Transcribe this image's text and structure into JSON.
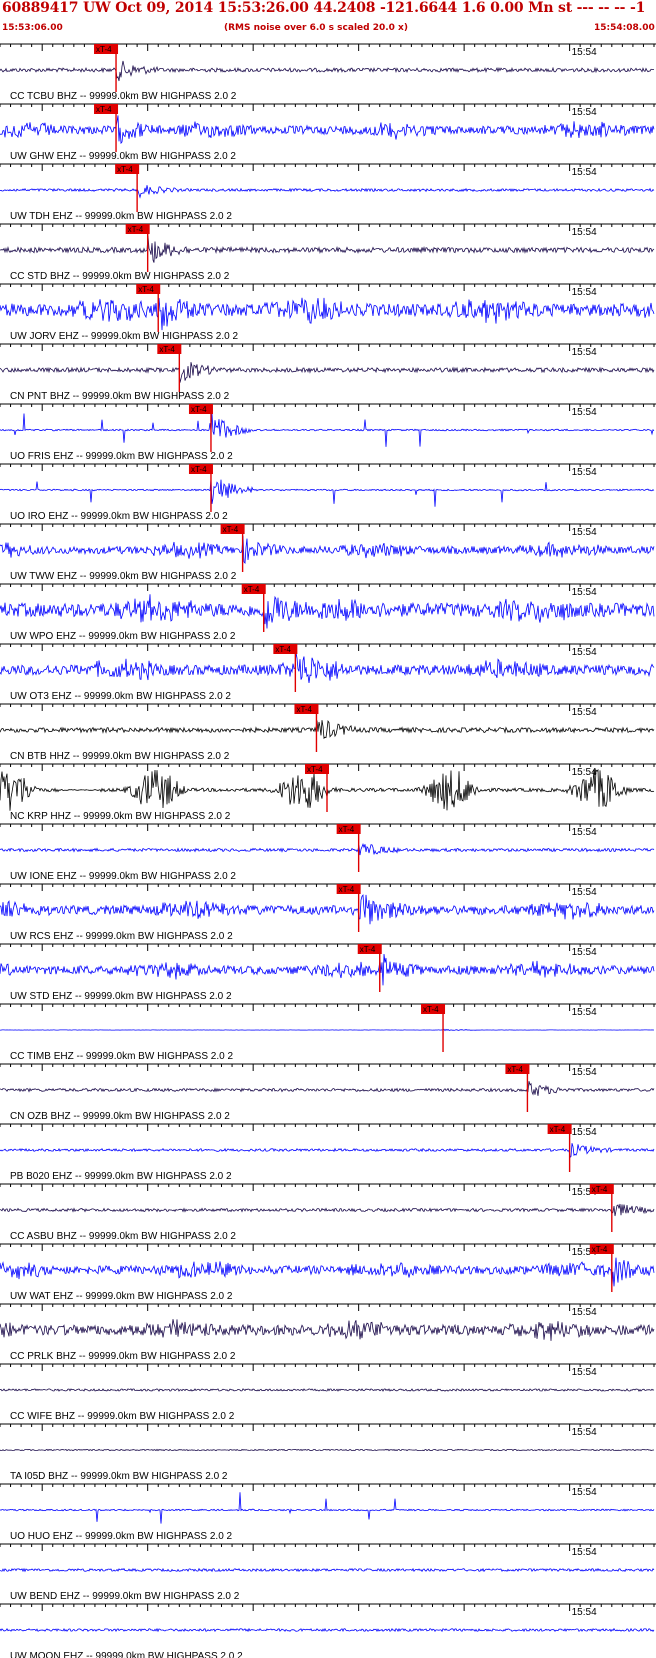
{
  "header": {
    "title": "60889417 UW Oct 09, 2014 15:53:26.00   44.2408 -121.6644  1.6 0.00 Mn st --- -- --  -1",
    "start_time": "15:53:06.00",
    "note": "(RMS noise over 6.0 s scaled 20.0 x)",
    "end_time": "15:54:08.00"
  },
  "colors": {
    "header_text": "#c00000",
    "pick": "#e00000",
    "blue_trace": "#0000ff",
    "dark_trace": "#1a0a4a",
    "black_trace": "#000000",
    "axis": "#000000"
  },
  "chart_data": {
    "type": "line",
    "xlim_seconds": [
      0,
      62
    ],
    "minute_tick_label": "15:54",
    "pick_label": "xT-4",
    "filter_suffix": "99999.0km BW  HIGHPASS  2.0  2",
    "traces": [
      {
        "station": "CC TCBU BHZ",
        "label": "CC TCBU BHZ --  99999.0km BW  HIGHPASS  2.0  2",
        "color": "dark",
        "pick_s": 11.0,
        "pattern": "burst",
        "amp": 0.45
      },
      {
        "station": "UW GHW EHZ",
        "label": "UW GHW EHZ --  99999.0km BW  HIGHPASS  2.0  2",
        "color": "blue",
        "pick_s": 11.0,
        "pattern": "noisy",
        "amp": 0.5
      },
      {
        "station": "UW TDH EHZ",
        "label": "UW TDH EHZ --  99999.0km BW  HIGHPASS  2.0  2",
        "color": "blue",
        "pick_s": 13.0,
        "pattern": "quiet",
        "amp": 0.3
      },
      {
        "station": "CC STD BHZ",
        "label": "CC STD BHZ --  99999.0km BW  HIGHPASS  2.0  2",
        "color": "dark",
        "pick_s": 14.0,
        "pattern": "burst",
        "amp": 0.6
      },
      {
        "station": "UW JORV EHZ",
        "label": "UW JORV EHZ --  99999.0km BW  HIGHPASS  2.0  2",
        "color": "blue",
        "pick_s": 15.0,
        "pattern": "noisy",
        "amp": 0.75
      },
      {
        "station": "CN PNT BHZ",
        "label": "CN PNT BHZ --  99999.0km BW  HIGHPASS  2.0  2",
        "color": "dark",
        "pick_s": 17.0,
        "pattern": "burst",
        "amp": 0.5
      },
      {
        "station": "UO FRIS EHZ",
        "label": "UO FRIS EHZ --  99999.0km BW  HIGHPASS  2.0  2",
        "color": "blue",
        "pick_s": 20.0,
        "pattern": "spikes",
        "amp": 0.8
      },
      {
        "station": "UO IRO EHZ",
        "label": "UO IRO EHZ --  99999.0km BW  HIGHPASS  2.0  2",
        "color": "blue",
        "pick_s": 20.0,
        "pattern": "spikes",
        "amp": 0.8
      },
      {
        "station": "UW TWW EHZ",
        "label": "UW TWW EHZ --  99999.0km BW  HIGHPASS  2.0  2",
        "color": "blue",
        "pick_s": 23.0,
        "pattern": "noisy",
        "amp": 0.45
      },
      {
        "station": "UW WPO EHZ",
        "label": "UW WPO EHZ --  99999.0km BW  HIGHPASS  2.0  2",
        "color": "blue",
        "pick_s": 25.0,
        "pattern": "noisy",
        "amp": 0.8
      },
      {
        "station": "UW OT3 EHZ",
        "label": "UW OT3 EHZ --  99999.0km BW  HIGHPASS  2.0  2",
        "color": "blue",
        "pick_s": 28.0,
        "pattern": "noisy",
        "amp": 0.6
      },
      {
        "station": "CN BTB HHZ",
        "label": "CN BTB HHZ --  99999.0km BW  HIGHPASS  2.0  2",
        "color": "black",
        "pick_s": 30.0,
        "pattern": "burst",
        "amp": 0.55
      },
      {
        "station": "NC KRP HHZ",
        "label": "NC KRP HHZ --  99999.0km BW  HIGHPASS  2.0  2",
        "color": "black",
        "pick_s": 31.0,
        "pattern": "waves",
        "amp": 0.9
      },
      {
        "station": "UW IONE EHZ",
        "label": "UW IONE EHZ --  99999.0km BW  HIGHPASS  2.0  2",
        "color": "blue",
        "pick_s": 34.0,
        "pattern": "quiet",
        "amp": 0.35
      },
      {
        "station": "UW RCS EHZ",
        "label": "UW RCS EHZ --  99999.0km BW  HIGHPASS  2.0  2",
        "color": "blue",
        "pick_s": 34.0,
        "pattern": "noisy",
        "amp": 0.55
      },
      {
        "station": "UW STD EHZ",
        "label": "UW STD EHZ --  99999.0km BW  HIGHPASS  2.0  2",
        "color": "blue",
        "pick_s": 36.0,
        "pattern": "noisy",
        "amp": 0.5
      },
      {
        "station": "CC TIMB EHZ",
        "label": "CC TIMB EHZ --  99999.0km BW  HIGHPASS  2.0  2",
        "color": "blue",
        "pick_s": 42.0,
        "pattern": "flat",
        "amp": 0.1
      },
      {
        "station": "CN OZB BHZ",
        "label": "CN OZB BHZ --  99999.0km BW  HIGHPASS  2.0  2",
        "color": "dark",
        "pick_s": 50.0,
        "pattern": "quiet",
        "amp": 0.35
      },
      {
        "station": "PB B020 EHZ",
        "label": "PB B020 EHZ --  99999.0km BW  HIGHPASS  2.0  2",
        "color": "blue",
        "pick_s": 54.0,
        "pattern": "quiet",
        "amp": 0.3
      },
      {
        "station": "CC ASBU BHZ",
        "label": "CC ASBU BHZ --  99999.0km BW  HIGHPASS  2.0  2",
        "color": "dark",
        "pick_s": 58.0,
        "pattern": "quiet",
        "amp": 0.35
      },
      {
        "station": "UW WAT EHZ",
        "label": "UW WAT EHZ --  99999.0km BW  HIGHPASS  2.0  2",
        "color": "blue",
        "pick_s": 58.0,
        "pattern": "noisy",
        "amp": 0.5
      },
      {
        "station": "CC PRLK BHZ",
        "label": "CC PRLK BHZ --  99999.0km BW  HIGHPASS  2.0  2",
        "color": "dark",
        "pick_s": null,
        "pattern": "noisy",
        "amp": 0.6
      },
      {
        "station": "CC WIFE BHZ",
        "label": "CC WIFE BHZ --  99999.0km BW  HIGHPASS  2.0  2",
        "color": "dark",
        "pick_s": null,
        "pattern": "quiet",
        "amp": 0.25
      },
      {
        "station": "TA I05D BHZ",
        "label": "TA I05D BHZ --  99999.0km BW  HIGHPASS  2.0  2",
        "color": "dark",
        "pick_s": null,
        "pattern": "quiet",
        "amp": 0.15
      },
      {
        "station": "UO HUO EHZ",
        "label": "UO HUO EHZ --  99999.0km BW  HIGHPASS  2.0  2",
        "color": "blue",
        "pick_s": null,
        "pattern": "spikes",
        "amp": 0.8
      },
      {
        "station": "UW BEND EHZ",
        "label": "UW BEND EHZ --  99999.0km BW  HIGHPASS  2.0  2",
        "color": "blue",
        "pick_s": null,
        "pattern": "quiet",
        "amp": 0.3
      },
      {
        "station": "UW MOON EHZ",
        "label": "UW MOON EHZ --  99999.0km BW  HIGHPASS  2.0  2",
        "color": "blue",
        "pick_s": null,
        "pattern": "quiet",
        "amp": 0.3
      }
    ]
  }
}
